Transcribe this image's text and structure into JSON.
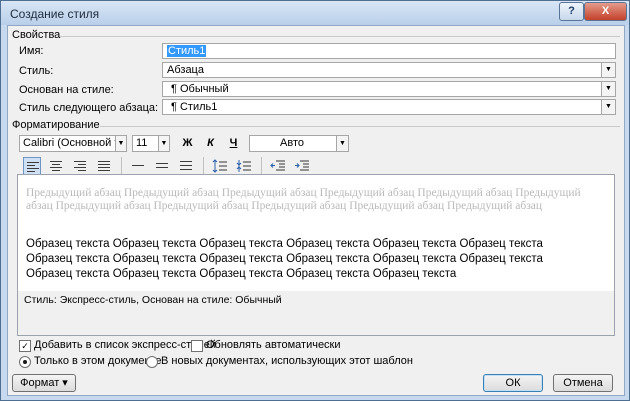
{
  "window": {
    "title": "Создание стиля",
    "help": "?",
    "close": "X"
  },
  "properties": {
    "section": "Свойства",
    "name_label": "Имя:",
    "name_value": "Стиль1",
    "style_label": "Стиль:",
    "style_value": "Абзаца",
    "based_label": "Основан на стиле:",
    "based_value": "¶ Обычный",
    "next_label": "Стиль следующего абзаца:",
    "next_value": "¶ Стиль1"
  },
  "formatting": {
    "section": "Форматирование",
    "font": "Calibri (Основной тек",
    "size": "11",
    "bold": "Ж",
    "italic": "К",
    "underline": "Ч",
    "color": "Авто"
  },
  "preview": {
    "previous_paragraph": "Предыдущий абзац Предыдущий абзац Предыдущий абзац Предыдущий абзац Предыдущий абзац Предыдущий абзац Предыдущий абзац Предыдущий абзац Предыдущий абзац Предыдущий абзац Предыдущий абзац",
    "sample_line1": "Образец текста Образец текста Образец текста Образец текста Образец текста Образец текста",
    "sample_line2": "Образец текста Образец текста Образец текста Образец текста Образец текста Образец текста",
    "sample_line3": "Образец текста Образец текста Образец текста Образец текста Образец текста"
  },
  "description": "Стиль: Экспресс-стиль, Основан на стиле: Обычный",
  "options": {
    "add_quick": "Добавить в список экспресс-стилей",
    "add_quick_checked": true,
    "auto_update": "Обновлять автоматически",
    "auto_update_checked": false,
    "only_doc": "Только в этом документе",
    "new_docs": "В новых документах, использующих этот шаблон"
  },
  "buttons": {
    "format": "Формат ▾",
    "ok": "ОК",
    "cancel": "Отмена"
  }
}
